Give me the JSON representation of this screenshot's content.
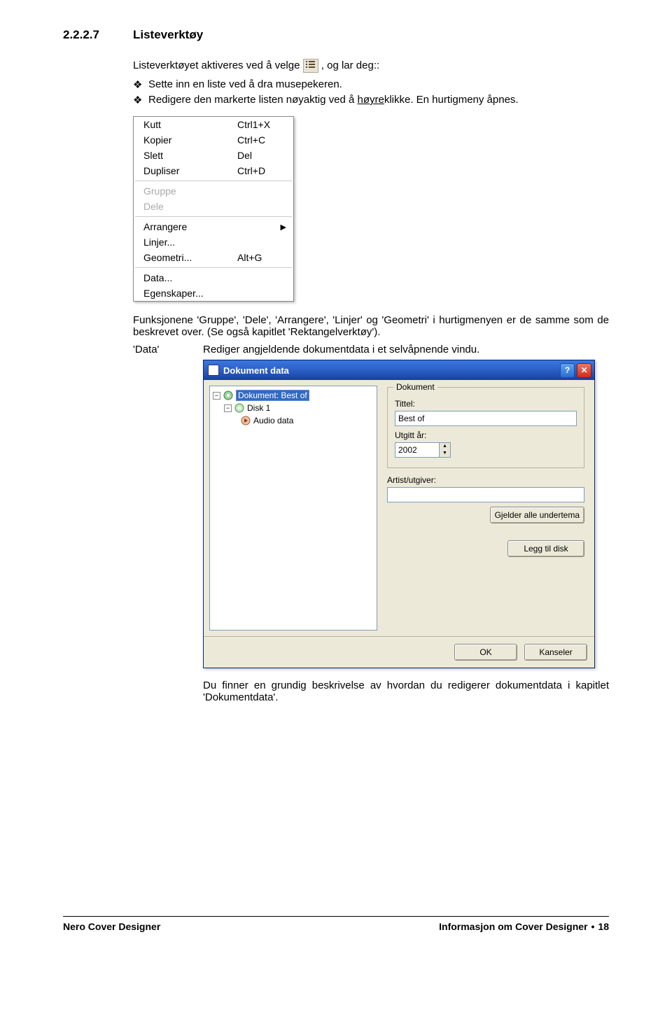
{
  "heading": {
    "number": "2.2.2.7",
    "title": "Listeverktøy"
  },
  "intro": {
    "line1a": "Listeverktøyet aktiveres ved å velge ",
    "line1b": ", og lar deg::",
    "bullet1": "Sette inn en liste ved å dra musepekeren.",
    "bullet2a": "Redigere den markerte listen nøyaktig ved å ",
    "bullet2_underline": "høyre",
    "bullet2b": "klikke. En hurtigmeny åpnes."
  },
  "context_menu": [
    {
      "label": "Kutt",
      "shortcut": "Ctrl1+X",
      "type": "item"
    },
    {
      "label": "Kopier",
      "shortcut": "Ctrl+C",
      "type": "item"
    },
    {
      "label": "Slett",
      "shortcut": "Del",
      "type": "item"
    },
    {
      "label": "Dupliser",
      "shortcut": "Ctrl+D",
      "type": "item"
    },
    {
      "type": "sep"
    },
    {
      "label": "Gruppe",
      "shortcut": "",
      "type": "disabled"
    },
    {
      "label": "Dele",
      "shortcut": "",
      "type": "disabled"
    },
    {
      "type": "sep"
    },
    {
      "label": "Arrangere",
      "shortcut": "",
      "type": "submenu"
    },
    {
      "label": "Linjer...",
      "shortcut": "",
      "type": "item"
    },
    {
      "label": "Geometri...",
      "shortcut": "Alt+G",
      "type": "item"
    },
    {
      "type": "sep"
    },
    {
      "label": "Data...",
      "shortcut": "",
      "type": "item"
    },
    {
      "label": "Egenskaper...",
      "shortcut": "",
      "type": "item"
    }
  ],
  "para_funk": "Funksjonene 'Gruppe', 'Dele', 'Arrangere', 'Linjer' og 'Geometri' i hurtigmenyen er de samme som de beskrevet over. (Se også kapitlet 'Rektangelverktøy').",
  "def": {
    "term": "'Data'",
    "body": "Rediger angjeldende dokumentdata i et selvåpnende vindu."
  },
  "dialog": {
    "title": "Dokument data",
    "tree": {
      "root": "Dokument: Best of",
      "child1": "Disk 1",
      "child2": "Audio data"
    },
    "fieldset_legend": "Dokument",
    "label_tittel": "Tittel:",
    "value_tittel": "Best of",
    "label_utgitt": "Utgitt år:",
    "value_utgitt": "2002",
    "label_artist": "Artist/utgiver:",
    "value_artist": "",
    "btn_gjelder": "Gjelder alle undertema",
    "btn_legg": "Legg til disk",
    "btn_ok": "OK",
    "btn_cancel": "Kanseler"
  },
  "para_end": "Du finner en grundig beskrivelse av hvordan du redigerer dokumentdata i kapitlet 'Dokumentdata'.",
  "footer": {
    "left": "Nero Cover Designer",
    "right_text": "Informasjon om Cover Designer",
    "right_page": "18"
  }
}
